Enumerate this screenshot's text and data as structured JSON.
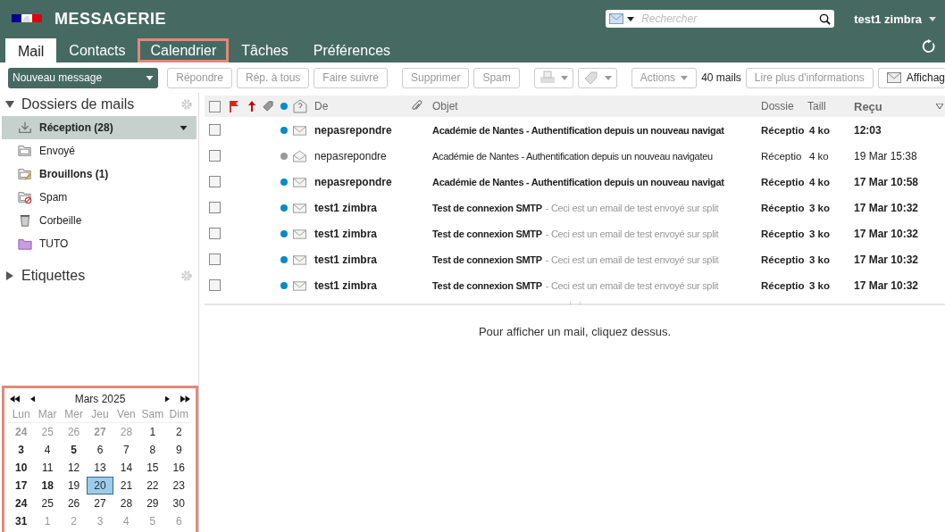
{
  "app": {
    "title": "MESSAGERIE",
    "search": {
      "placeholder": "Rechercher"
    },
    "user": "test1 zimbra"
  },
  "tabs": [
    {
      "label": "Mail",
      "selected": true,
      "highlighted": false
    },
    {
      "label": "Contacts",
      "selected": false,
      "highlighted": false
    },
    {
      "label": "Calendrier",
      "selected": false,
      "highlighted": true
    },
    {
      "label": "Tâches",
      "selected": false,
      "highlighted": false
    },
    {
      "label": "Préférences",
      "selected": false,
      "highlighted": false
    }
  ],
  "new_message": "Nouveau message",
  "toolbar": [
    {
      "kind": "text",
      "label": "Répondre",
      "disabled": true
    },
    {
      "kind": "text",
      "label": "Rép. à tous",
      "disabled": true
    },
    {
      "kind": "text",
      "label": "Faire suivre",
      "disabled": true
    },
    {
      "kind": "gap"
    },
    {
      "kind": "text",
      "label": "Supprimer",
      "disabled": true
    },
    {
      "kind": "text",
      "label": "Spam",
      "disabled": true
    },
    {
      "kind": "gap"
    },
    {
      "kind": "print",
      "disabled": true
    },
    {
      "kind": "tag",
      "disabled": true
    },
    {
      "kind": "gap"
    },
    {
      "kind": "menu",
      "label": "Actions",
      "disabled": true
    },
    {
      "kind": "count",
      "label": "40 mails"
    },
    {
      "kind": "text",
      "label": "Lire plus d'informations",
      "disabled": true
    },
    {
      "kind": "view",
      "label": "Affichag",
      "disabled": false
    }
  ],
  "folders_header": {
    "label": "Dossiers de mails",
    "expanded": true
  },
  "folders": [
    {
      "kind": "inbox",
      "label": "Réception (28)",
      "unread": true,
      "selected": true
    },
    {
      "kind": "sent",
      "label": "Envoyé",
      "unread": false,
      "selected": false
    },
    {
      "kind": "drafts",
      "label": "Brouillons (1)",
      "unread": true,
      "selected": false
    },
    {
      "kind": "spam",
      "label": "Spam",
      "unread": false,
      "selected": false
    },
    {
      "kind": "trash",
      "label": "Corbeille",
      "unread": false,
      "selected": false
    },
    {
      "kind": "folder",
      "label": "TUTO",
      "unread": false,
      "selected": false,
      "color": "#c79ce0"
    }
  ],
  "tags_header": {
    "label": "Etiquettes",
    "expanded": false
  },
  "mini_calendar": {
    "month": "Mars 2025",
    "highlighted": true,
    "weekdays": [
      "Lun",
      "Mar",
      "Mer",
      "Jeu",
      "Ven",
      "Sam",
      "Dim"
    ],
    "weeks": [
      [
        {
          "d": "24",
          "other": true,
          "bold": true,
          "selected": false
        },
        {
          "d": "25",
          "other": true,
          "bold": false,
          "selected": false
        },
        {
          "d": "26",
          "other": true,
          "bold": false,
          "selected": false
        },
        {
          "d": "27",
          "other": true,
          "bold": true,
          "selected": false
        },
        {
          "d": "28",
          "other": true,
          "bold": false,
          "selected": false
        },
        {
          "d": "1",
          "other": false,
          "bold": false,
          "selected": false
        },
        {
          "d": "2",
          "other": false,
          "bold": false,
          "selected": false
        }
      ],
      [
        {
          "d": "3",
          "other": false,
          "bold": true,
          "selected": false
        },
        {
          "d": "4",
          "other": false,
          "bold": false,
          "selected": false
        },
        {
          "d": "5",
          "other": false,
          "bold": true,
          "selected": false
        },
        {
          "d": "6",
          "other": false,
          "bold": false,
          "selected": false
        },
        {
          "d": "7",
          "other": false,
          "bold": false,
          "selected": false
        },
        {
          "d": "8",
          "other": false,
          "bold": false,
          "selected": false
        },
        {
          "d": "9",
          "other": false,
          "bold": false,
          "selected": false
        }
      ],
      [
        {
          "d": "10",
          "other": false,
          "bold": true,
          "selected": false
        },
        {
          "d": "11",
          "other": false,
          "bold": false,
          "selected": false
        },
        {
          "d": "12",
          "other": false,
          "bold": false,
          "selected": false
        },
        {
          "d": "13",
          "other": false,
          "bold": false,
          "selected": false
        },
        {
          "d": "14",
          "other": false,
          "bold": false,
          "selected": false
        },
        {
          "d": "15",
          "other": false,
          "bold": false,
          "selected": false
        },
        {
          "d": "16",
          "other": false,
          "bold": false,
          "selected": false
        }
      ],
      [
        {
          "d": "17",
          "other": false,
          "bold": true,
          "selected": false
        },
        {
          "d": "18",
          "other": false,
          "bold": true,
          "selected": false
        },
        {
          "d": "19",
          "other": false,
          "bold": false,
          "selected": false
        },
        {
          "d": "20",
          "other": false,
          "bold": false,
          "selected": true
        },
        {
          "d": "21",
          "other": false,
          "bold": false,
          "selected": false
        },
        {
          "d": "22",
          "other": false,
          "bold": false,
          "selected": false
        },
        {
          "d": "23",
          "other": false,
          "bold": false,
          "selected": false
        }
      ],
      [
        {
          "d": "24",
          "other": false,
          "bold": true,
          "selected": false
        },
        {
          "d": "25",
          "other": false,
          "bold": false,
          "selected": false
        },
        {
          "d": "26",
          "other": false,
          "bold": false,
          "selected": false
        },
        {
          "d": "27",
          "other": false,
          "bold": false,
          "selected": false
        },
        {
          "d": "28",
          "other": false,
          "bold": false,
          "selected": false
        },
        {
          "d": "29",
          "other": false,
          "bold": false,
          "selected": false
        },
        {
          "d": "30",
          "other": false,
          "bold": false,
          "selected": false
        }
      ],
      [
        {
          "d": "31",
          "other": false,
          "bold": true,
          "selected": false
        },
        {
          "d": "1",
          "other": true,
          "bold": false,
          "selected": false
        },
        {
          "d": "2",
          "other": true,
          "bold": false,
          "selected": false
        },
        {
          "d": "3",
          "other": true,
          "bold": false,
          "selected": false
        },
        {
          "d": "4",
          "other": true,
          "bold": false,
          "selected": false
        },
        {
          "d": "5",
          "other": true,
          "bold": false,
          "selected": false
        },
        {
          "d": "6",
          "other": true,
          "bold": false,
          "selected": false
        }
      ]
    ]
  },
  "list": {
    "select_all_checked": false,
    "columns": {
      "from": "De",
      "subject": "Objet",
      "folder": "Dossie",
      "size": "Taill",
      "received": "Reçu"
    },
    "rows": [
      {
        "unread": true,
        "color": "#0a8ac8",
        "from": "nepasrepondre",
        "subject": "Académie de Nantes - Authentification depuis un nouveau navigat",
        "fragment": "",
        "folder": "Réceptio",
        "size": "4 ko",
        "received": "12:03"
      },
      {
        "unread": false,
        "color": "#999999",
        "from": "nepasrepondre",
        "subject": "Académie de Nantes - Authentification depuis un nouveau navigateu",
        "fragment": "",
        "folder": "Réceptio",
        "size": "4 ko",
        "received": "19 Mar 15:38"
      },
      {
        "unread": true,
        "color": "#0a8ac8",
        "from": "nepasrepondre",
        "subject": "Académie de Nantes - Authentification depuis un nouveau navigat",
        "fragment": "",
        "folder": "Réceptio",
        "size": "4 ko",
        "received": "17 Mar 10:58"
      },
      {
        "unread": true,
        "color": "#0a8ac8",
        "from": "test1 zimbra",
        "subject": "Test de connexion SMTP",
        "fragment": "- Ceci est un email de test envoyé sur split",
        "folder": "Réceptio",
        "size": "3 ko",
        "received": "17 Mar 10:32"
      },
      {
        "unread": true,
        "color": "#0a8ac8",
        "from": "test1 zimbra",
        "subject": "Test de connexion SMTP",
        "fragment": "- Ceci est un email de test envoyé sur split",
        "folder": "Réceptio",
        "size": "3 ko",
        "received": "17 Mar 10:32"
      },
      {
        "unread": true,
        "color": "#0a8ac8",
        "from": "test1 zimbra",
        "subject": "Test de connexion SMTP",
        "fragment": "- Ceci est un email de test envoyé sur split",
        "folder": "Réceptio",
        "size": "3 ko",
        "received": "17 Mar 10:32"
      },
      {
        "unread": true,
        "color": "#0a8ac8",
        "from": "test1 zimbra",
        "subject": "Test de connexion SMTP",
        "fragment": "- Ceci est un email de test envoyé sur split",
        "folder": "Réceptio",
        "size": "3 ko",
        "received": "17 Mar 10:32"
      }
    ]
  },
  "reading_pane": "Pour afficher un mail, cliquez dessus."
}
